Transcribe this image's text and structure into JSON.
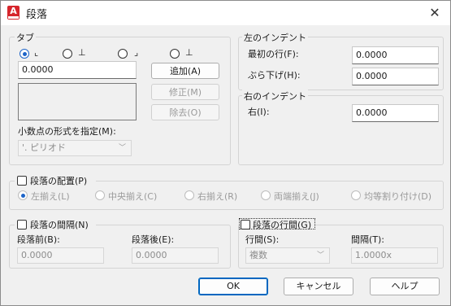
{
  "window": {
    "title": "段落",
    "app_icon_letter": "A"
  },
  "tabs_group": {
    "label": "タブ",
    "tab_types": [
      {
        "symbol": "⌞",
        "selected": true
      },
      {
        "symbol": "⊥",
        "selected": false
      },
      {
        "symbol": "⌟",
        "selected": false
      },
      {
        "symbol": "⊥",
        "selected": false
      }
    ],
    "position_value": "0.0000",
    "add_button": "追加(A)",
    "modify_button": "修正(M)",
    "delete_button": "除去(O)",
    "decimal_format_label": "小数点の形式を指定(M):",
    "decimal_format_value": "'. ピリオド"
  },
  "left_indent": {
    "label": "左のインデント",
    "first_line_label": "最初の行(F):",
    "first_line_value": "0.0000",
    "hanging_label": "ぶら下げ(H):",
    "hanging_value": "0.0000"
  },
  "right_indent": {
    "label": "右のインデント",
    "right_label": "右(I):",
    "right_value": "0.0000"
  },
  "alignment": {
    "label": "段落の配置(P)",
    "options": [
      "左揃え(L)",
      "中央揃え(C)",
      "右揃え(R)",
      "両端揃え(J)",
      "均等割り付け(D)"
    ]
  },
  "spacing": {
    "label": "段落の間隔(N)",
    "before_label": "段落前(B):",
    "before_value": "0.0000",
    "after_label": "段落後(E):",
    "after_value": "0.0000"
  },
  "line_spacing": {
    "label": "段落の行間(G)",
    "spacing_label": "行間(S):",
    "spacing_value": "複数",
    "interval_label": "間隔(T):",
    "interval_value": "1.0000x"
  },
  "buttons": {
    "ok": "OK",
    "cancel": "キャンセル",
    "help": "ヘルプ"
  }
}
